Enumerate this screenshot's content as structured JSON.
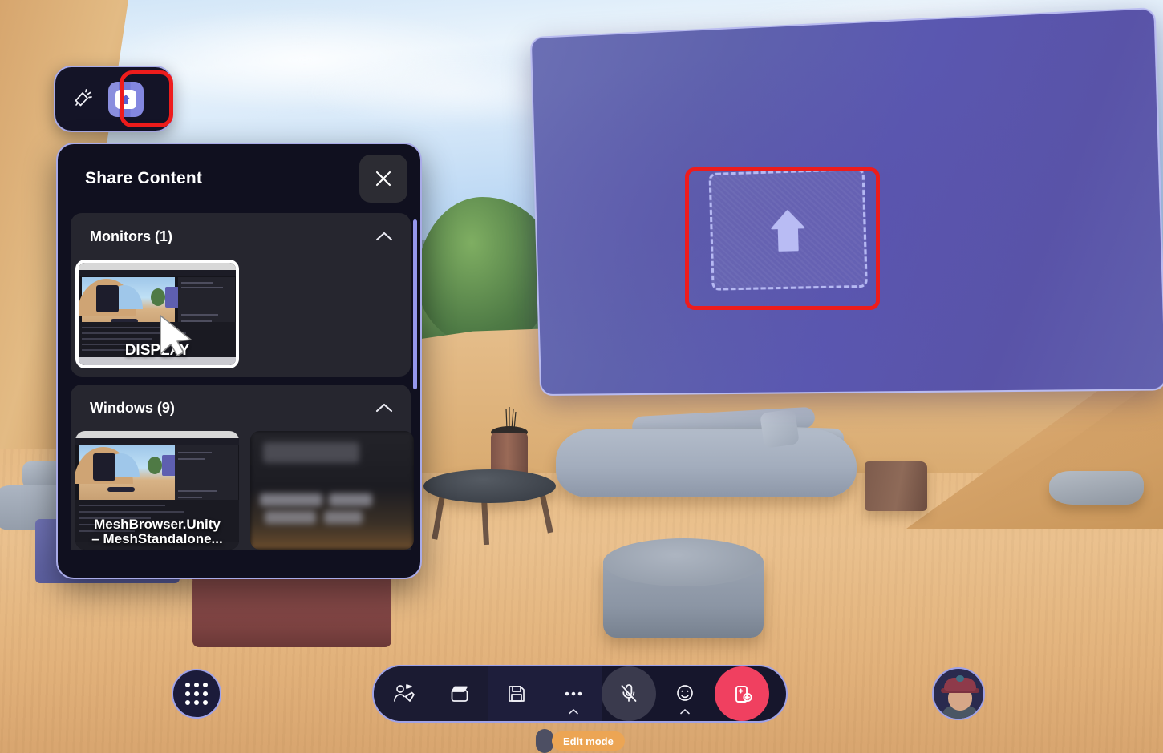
{
  "scene": {
    "environment_name": "virtual-lounge",
    "shared_screen": {
      "dropzone_icon": "upload-arrow-icon"
    }
  },
  "share_toggle_bar": {
    "present_icon": "megaphone-icon",
    "share_screen_icon": "share-screen-up-arrow-icon"
  },
  "annotations": {
    "highlight_color": "#ee1c1c"
  },
  "share_panel": {
    "title": "Share Content",
    "close_icon": "close-icon",
    "sections": [
      {
        "title": "Monitors (1)",
        "collapse_icon": "chevron-up-icon",
        "items": [
          {
            "label": "DISPLAY",
            "selected": true,
            "cursor_icon": "mouse-pointer-icon"
          }
        ]
      },
      {
        "title": "Windows (9)",
        "collapse_icon": "chevron-up-icon",
        "items": [
          {
            "label": "MeshBrowser.Unity – MeshStandalone...",
            "line1": "MeshBrowser.Unity",
            "line2": "– MeshStandalone...",
            "selected": false
          },
          {
            "label": "",
            "selected": false
          }
        ]
      }
    ]
  },
  "bottom_bar": {
    "app_grid_icon": "app-grid-icon",
    "buttons": [
      {
        "name": "reactions-button",
        "icon": "reactions-icon"
      },
      {
        "name": "clapperboard-button",
        "icon": "clapperboard-icon"
      },
      {
        "name": "save-button",
        "icon": "floppy-disk-icon"
      },
      {
        "name": "more-options-button",
        "icon": "ellipsis-icon",
        "overflow_icon": "chevron-up-small-icon"
      },
      {
        "name": "microphone-button",
        "icon": "microphone-muted-icon",
        "state": "muted"
      },
      {
        "name": "emoji-button",
        "icon": "smiley-face-icon",
        "overflow_icon": "chevron-up-small-icon"
      },
      {
        "name": "leave-button",
        "icon": "leave-call-icon",
        "color": "#f04060"
      }
    ]
  },
  "status": {
    "edit_mode_label": "Edit mode",
    "edit_mode_color": "#eca554"
  },
  "user": {
    "avatar_icon": "user-avatar"
  }
}
